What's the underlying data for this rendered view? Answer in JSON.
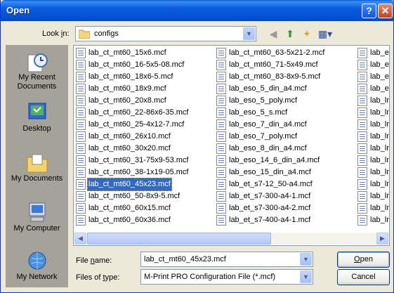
{
  "window": {
    "title": "Open"
  },
  "look_in": {
    "label": "Look in:",
    "label_prefix": "Look ",
    "label_accel": "i",
    "label_suffix": "n:",
    "value": "configs"
  },
  "places": [
    {
      "label": "My Recent Documents",
      "icon": "recent-documents-icon"
    },
    {
      "label": "Desktop",
      "icon": "desktop-icon"
    },
    {
      "label": "My Documents",
      "icon": "my-documents-icon"
    },
    {
      "label": "My Computer",
      "icon": "my-computer-icon"
    },
    {
      "label": "My Network",
      "icon": "my-network-icon"
    }
  ],
  "files": {
    "col1": [
      "lab_ct_mt60_15x6.mcf",
      "lab_ct_mt60_16-5x5-08.mcf",
      "lab_ct_mt60_18x6-5.mcf",
      "lab_ct_mt60_18x9.mcf",
      "lab_ct_mt60_20x8.mcf",
      "lab_ct_mt60_22-86x6-35.mcf",
      "lab_ct_mt60_25-4x12-7.mcf",
      "lab_ct_mt60_26x10.mcf",
      "lab_ct_mt60_30x20.mcf",
      "lab_ct_mt60_31-75x9-53.mcf",
      "lab_ct_mt60_38-1x19-05.mcf",
      "lab_ct_mt60_45x23.mcf",
      "lab_ct_mt60_50-8x9-5.mcf",
      "lab_ct_mt60_60x15.mcf",
      "lab_ct_mt60_60x36.mcf"
    ],
    "col2": [
      "lab_ct_mt60_63-5x21-2.mcf",
      "lab_ct_mt60_71-5x49.mcf",
      "lab_ct_mt60_83-8x9-5.mcf",
      "lab_eso_5_din_a4.mcf",
      "lab_eso_5_poly.mcf",
      "lab_eso_5_s.mcf",
      "lab_eso_7_din_a4.mcf",
      "lab_eso_7_poly.mcf",
      "lab_eso_8_din_a4.mcf",
      "lab_eso_14_6_din_a4.mcf",
      "lab_eso_15_din_a4.mcf",
      "lab_et_s7-12_50-a4.mcf",
      "lab_et_s7-300-a4-1.mcf",
      "lab_et_s7-300-a4-2.mcf",
      "lab_et_s7-400-a4-1.mcf"
    ],
    "col3": [
      "lab_et",
      "lab_et",
      "lab_et",
      "lab_et",
      "lab_lm",
      "lab_lm",
      "lab_lm",
      "lab_lm",
      "lab_lm",
      "lab_lm",
      "lab_lm",
      "lab_lm",
      "lab_lm",
      "lab_lm",
      "lab_lm"
    ],
    "selected": "lab_ct_mt60_45x23.mcf"
  },
  "file_name": {
    "label_prefix": "File ",
    "label_accel": "n",
    "label_suffix": "ame:",
    "value": "lab_ct_mt60_45x23.mcf"
  },
  "file_type": {
    "label_prefix": "Files of ",
    "label_accel": "t",
    "label_suffix": "ype:",
    "value": "M-Print PRO Configuration File (*.mcf)"
  },
  "buttons": {
    "open_prefix": "",
    "open_accel": "O",
    "open_suffix": "pen",
    "cancel": "Cancel"
  }
}
